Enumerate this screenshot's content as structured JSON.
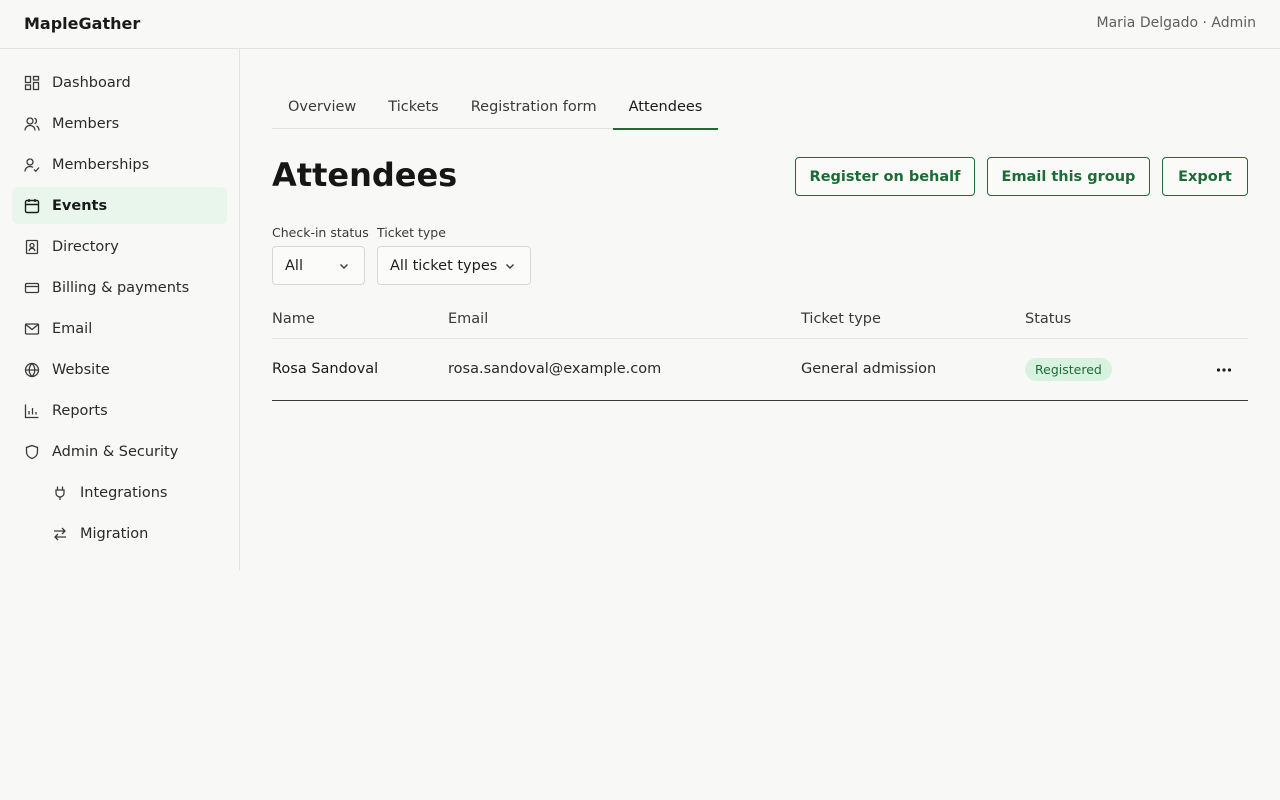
{
  "header": {
    "brand": "MapleGather",
    "user": "Maria Delgado · Admin"
  },
  "sidebar": {
    "items": [
      {
        "label": "Dashboard",
        "icon": "dashboard-icon"
      },
      {
        "label": "Members",
        "icon": "members-icon"
      },
      {
        "label": "Memberships",
        "icon": "memberships-icon"
      },
      {
        "label": "Events",
        "icon": "calendar-icon",
        "active": true
      },
      {
        "label": "Directory",
        "icon": "directory-icon"
      },
      {
        "label": "Billing & payments",
        "icon": "credit-card-icon"
      },
      {
        "label": "Email",
        "icon": "mail-icon"
      },
      {
        "label": "Website",
        "icon": "globe-icon"
      },
      {
        "label": "Reports",
        "icon": "bar-chart-icon"
      },
      {
        "label": "Admin & Security",
        "icon": "shield-icon"
      },
      {
        "label": "Integrations",
        "icon": "plug-icon"
      },
      {
        "label": "Migration",
        "icon": "swap-arrows-icon"
      }
    ]
  },
  "tabs": [
    {
      "label": "Overview"
    },
    {
      "label": "Tickets"
    },
    {
      "label": "Registration form"
    },
    {
      "label": "Attendees",
      "active": true
    }
  ],
  "main": {
    "title": "Attendees",
    "actions": {
      "register": "Register on behalf",
      "email": "Email this group",
      "export": "Export"
    },
    "filters": {
      "checkin_label": "Check-in status",
      "checkin_value": "All",
      "ticket_label": "Ticket type",
      "ticket_value": "All ticket types"
    },
    "table": {
      "columns": [
        "Name",
        "Email",
        "Ticket type",
        "Status"
      ],
      "rows": [
        {
          "name": "Rosa Sandoval",
          "email": "rosa.sandoval@example.com",
          "ticket_type": "General admission",
          "status": "Registered"
        }
      ]
    }
  },
  "colors": {
    "accent": "#1d6b36",
    "active_nav_bg": "#e8f6ec",
    "badge_bg": "#d7f3e0"
  }
}
